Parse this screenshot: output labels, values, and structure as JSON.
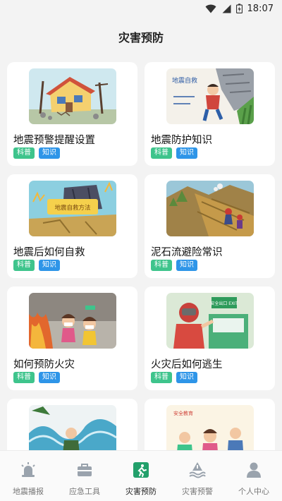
{
  "status": {
    "time": "18:07"
  },
  "header": {
    "title": "灾害预防"
  },
  "colors": {
    "tag_science": "#3ec48c",
    "tag_knowledge": "#2e95e8",
    "tab_active": "#22a06b",
    "tab_inactive": "#9aa3ad"
  },
  "cards": [
    {
      "title": "地震预警提醒设置",
      "tags": [
        "科普",
        "知识"
      ],
      "image": "house-quake-illustration"
    },
    {
      "title": "地震防护知识",
      "tags": [
        "科普",
        "知识"
      ],
      "image": "child-shelter-illustration",
      "image_text": "地震自救"
    },
    {
      "title": "地震后如何自救",
      "tags": [
        "科普",
        "知识"
      ],
      "image": "quake-selfrescue-illustration",
      "image_text": "地震自救方法"
    },
    {
      "title": "泥石流避险常识",
      "tags": [
        "科普",
        "知识"
      ],
      "image": "mudslide-illustration"
    },
    {
      "title": "如何预防火灾",
      "tags": [
        "科普",
        "知识"
      ],
      "image": "fire-escape-children-illustration"
    },
    {
      "title": "火灾后如何逃生",
      "tags": [
        "科普",
        "知识"
      ],
      "image": "exit-sign-illustration",
      "image_text": "安全出口 EXIT"
    },
    {
      "title": "",
      "tags": [],
      "image": "flood-illustration"
    },
    {
      "title": "",
      "tags": [],
      "image": "safety-education-illustration",
      "image_text": "安全教育"
    }
  ],
  "tabs": [
    {
      "label": "地震播报",
      "icon": "alarm-light-icon",
      "active": false
    },
    {
      "label": "应急工具",
      "icon": "toolbox-icon",
      "active": false
    },
    {
      "label": "灾害预防",
      "icon": "running-exit-icon",
      "active": true
    },
    {
      "label": "灾害预警",
      "icon": "warning-wave-icon",
      "active": false
    },
    {
      "label": "个人中心",
      "icon": "person-icon",
      "active": false
    }
  ]
}
